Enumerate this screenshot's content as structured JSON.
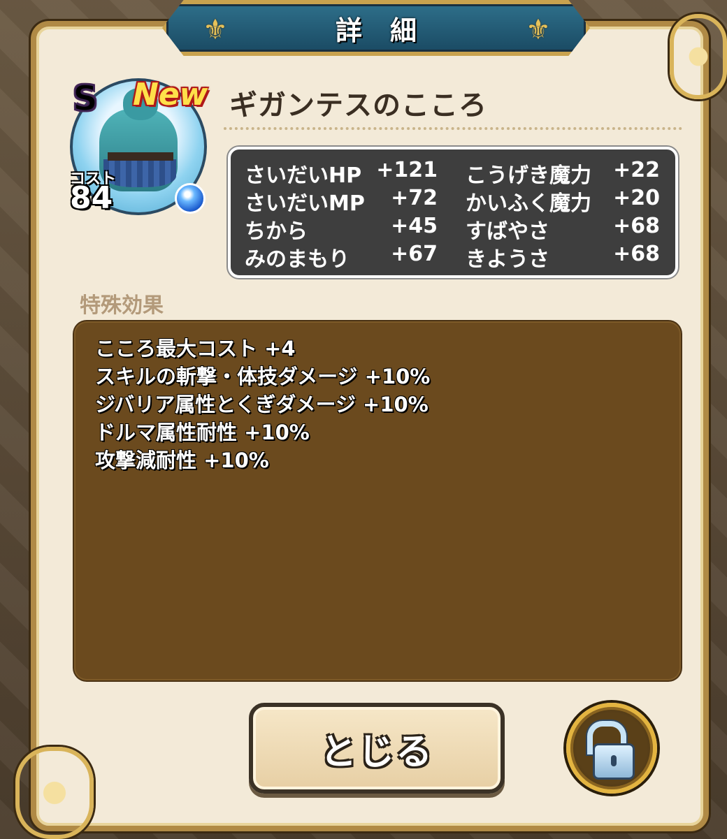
{
  "dialog": {
    "title": "詳細",
    "item_name": "ギガンテスのこころ",
    "rank": "S",
    "new_badge": "New",
    "cost_label": "コスト",
    "cost_value": "84"
  },
  "stats": [
    {
      "label_left": "さいだいHP",
      "value_left": "+121",
      "label_right": "こうげき魔力",
      "value_right": "+22"
    },
    {
      "label_left": "さいだいMP",
      "value_left": "+72",
      "label_right": "かいふく魔力",
      "value_right": "+20"
    },
    {
      "label_left": "ちから",
      "value_left": "+45",
      "label_right": "すばやさ",
      "value_right": "+68"
    },
    {
      "label_left": "みのまもり",
      "value_left": "+67",
      "label_right": "きようさ",
      "value_right": "+68"
    }
  ],
  "special_effects": {
    "heading": "特殊効果",
    "lines": [
      "こころ最大コスト +4",
      "スキルの斬撃・体技ダメージ +10%",
      "ジバリア属性とくぎダメージ +10%",
      "ドルマ属性耐性 +10%",
      "攻撃減耐性 +10%"
    ]
  },
  "buttons": {
    "close_label": "とじる",
    "lock_icon": "unlock-icon"
  },
  "colors": {
    "panel_bg": "#f3ead8",
    "title_plate": "#1a4a63",
    "stats_bg": "#3e3e3e",
    "effect_bg": "#6b4a1e",
    "gold_border": "#d9b45a"
  }
}
